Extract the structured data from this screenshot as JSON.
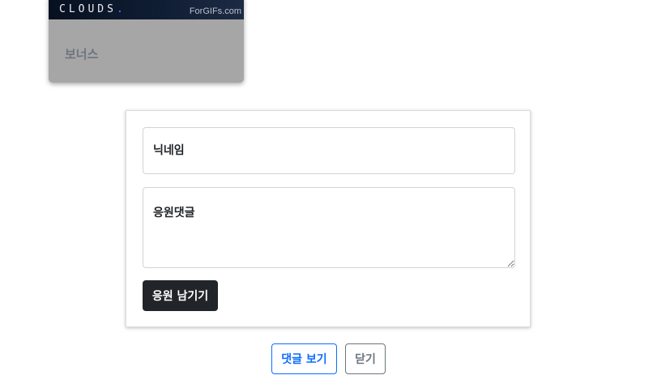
{
  "card": {
    "image_title": "CLOUDS",
    "image_title_dot": ".",
    "watermark": "ForGIFs.com",
    "label": "보너스"
  },
  "form": {
    "nickname_placeholder": "닉네임",
    "comment_placeholder": "응원댓글",
    "submit_label": "응원 남기기"
  },
  "actions": {
    "view_comments_label": "댓글 보기",
    "close_label": "닫기"
  },
  "colors": {
    "primary": "#0d6efd",
    "dark": "#212529",
    "secondary": "#6c757d",
    "card_bg": "#a6a6a6"
  }
}
